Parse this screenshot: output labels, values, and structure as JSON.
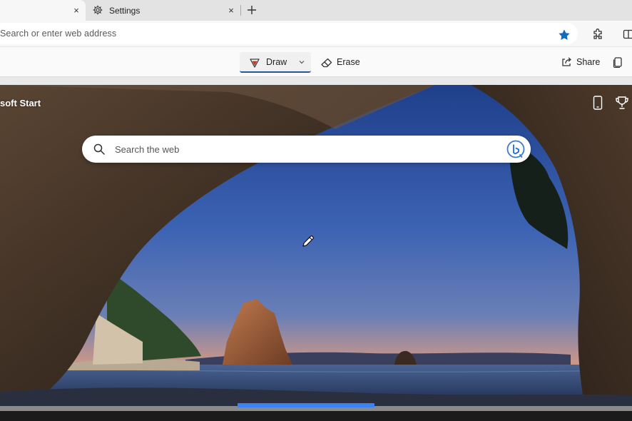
{
  "tabs": [
    {
      "label": "",
      "close": "×",
      "active": true
    },
    {
      "label": "Settings",
      "close": "×",
      "icon": "gear-icon",
      "active": false
    }
  ],
  "new_tab_label": "+",
  "address_bar": {
    "placeholder": "Search or enter web address",
    "favorite_icon": "star-icon",
    "favorite_color": "#0f6cbd"
  },
  "draw_toolbar": {
    "draw_label": "Draw",
    "erase_label": "Erase",
    "share_label": "Share",
    "pen_color": "#c0392b",
    "accent": "#2b5797"
  },
  "page": {
    "brand": "soft Start",
    "search_placeholder": "Search the web",
    "bing_icon": "bing-icon",
    "scroll_color": "#3b82f6"
  }
}
